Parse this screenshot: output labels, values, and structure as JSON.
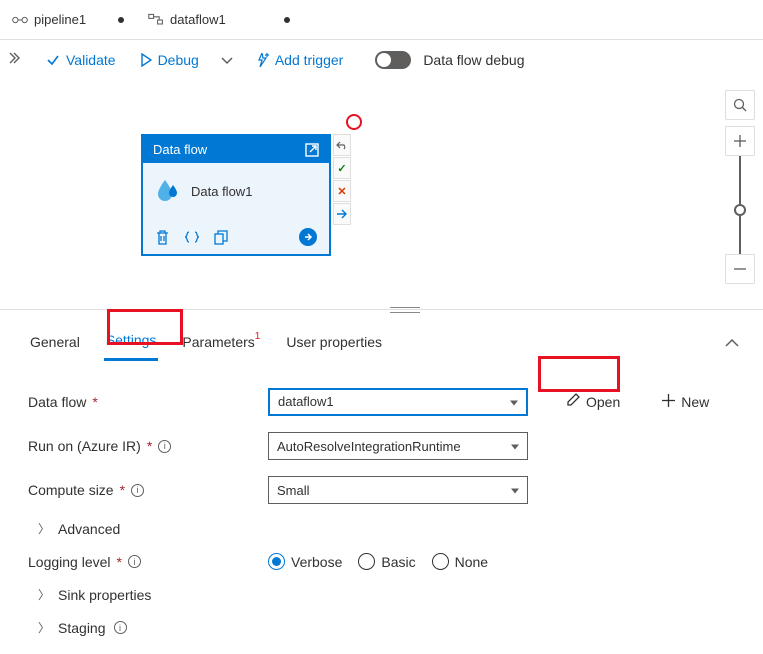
{
  "tabs": {
    "pipeline": "pipeline1",
    "dataflow": "dataflow1"
  },
  "toolbar": {
    "validate": "Validate",
    "debug": "Debug",
    "add_trigger": "Add trigger",
    "flow_debug": "Data flow debug"
  },
  "node": {
    "header": "Data flow",
    "title": "Data flow1"
  },
  "detail_tabs": {
    "general": "General",
    "settings": "Settings",
    "parameters": "Parameters",
    "params_badge": "1",
    "user_props": "User properties"
  },
  "form": {
    "dataflow_label": "Data flow",
    "dataflow_value": "dataflow1",
    "open": "Open",
    "new": "New",
    "runon_label": "Run on (Azure IR)",
    "runon_value": "AutoResolveIntegrationRuntime",
    "compute_label": "Compute size",
    "compute_value": "Small",
    "advanced": "Advanced",
    "logging_label": "Logging level",
    "radio_verbose": "Verbose",
    "radio_basic": "Basic",
    "radio_none": "None",
    "sink": "Sink properties",
    "staging": "Staging"
  }
}
